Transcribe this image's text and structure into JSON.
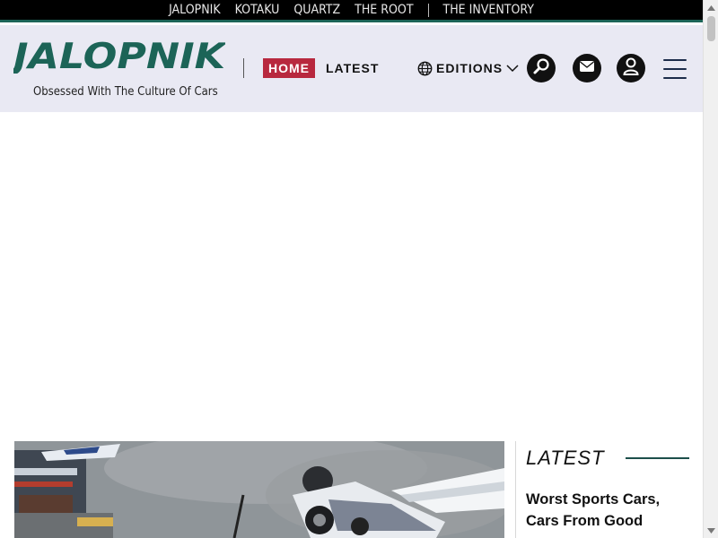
{
  "network": {
    "items": [
      "JALOPNIK",
      "KOTAKU",
      "QUARTZ",
      "THE ROOT",
      "THE INVENTORY"
    ]
  },
  "header": {
    "logo_text": "JALOPNIK",
    "tagline": "Obsessed With The Culture Of Cars",
    "nav": {
      "home": "HOME",
      "latest": "LATEST",
      "editions": "EDITIONS"
    }
  },
  "sidebar": {
    "title": "LATEST",
    "headline": "Worst Sports Cars, Cars From Good"
  },
  "colors": {
    "brand_green": "#1c6457",
    "home_red": "#b8283e",
    "header_bg": "#e9e9f3"
  },
  "icons": [
    "globe-icon",
    "chevron-down-icon",
    "search-icon",
    "mail-icon",
    "user-icon",
    "menu-icon"
  ]
}
